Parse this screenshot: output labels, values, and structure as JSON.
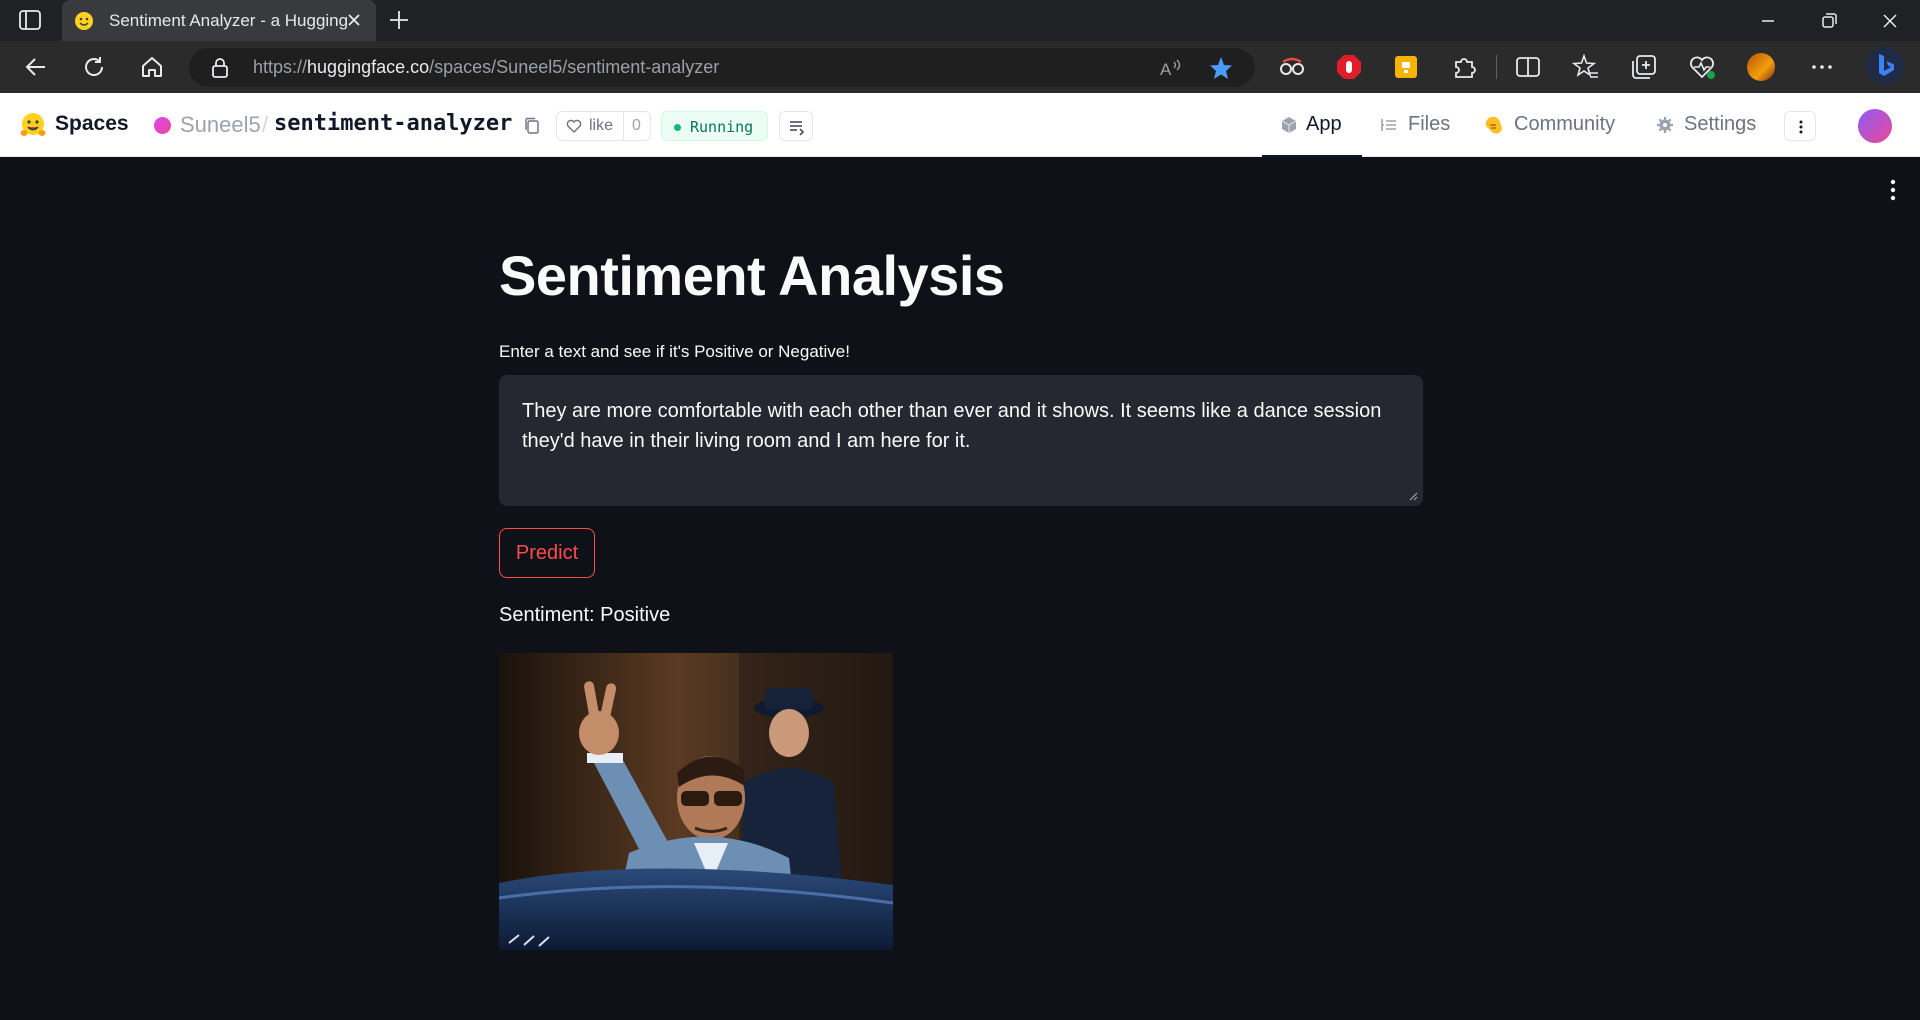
{
  "browser": {
    "tab_title": "Sentiment Analyzer - a Hugging",
    "url_prefix": "https://",
    "url_host": "huggingface.co",
    "url_path": "/spaces/Suneel5/sentiment-analyzer",
    "accent_color": "#4a9cff"
  },
  "hf_header": {
    "spaces_label": "Spaces",
    "owner": "Suneel5",
    "separator": "/",
    "repo": "sentiment-analyzer",
    "like_label": "like",
    "like_count": "0",
    "status": "Running",
    "tabs": [
      {
        "label": "App",
        "icon": "cube-icon",
        "active": true
      },
      {
        "label": "Files",
        "icon": "files-icon",
        "active": false
      },
      {
        "label": "Community",
        "icon": "community-icon",
        "active": false
      },
      {
        "label": "Settings",
        "icon": "gear-icon",
        "active": false
      }
    ]
  },
  "app": {
    "title": "Sentiment Analysis",
    "input_label": "Enter a text and see if it's Positive or Negative!",
    "input_value": "They are more comfortable with each other than ever and it shows. It seems like a dance session they'd have in their living room and I am here for it.",
    "predict_label": "Predict",
    "result": "Sentiment: Positive",
    "button_color": "#ff4b4b",
    "background_color": "#0e1117",
    "input_background": "#262730"
  }
}
